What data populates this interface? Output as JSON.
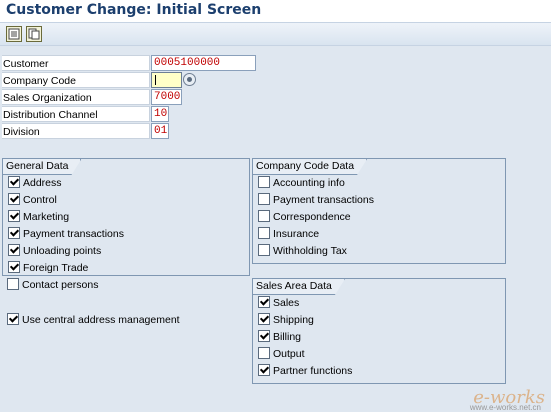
{
  "window": {
    "title": "Customer Change: Initial Screen"
  },
  "toolbar": {
    "buttons": [
      "select-data-icon",
      "copy-icon"
    ]
  },
  "fields": [
    {
      "label": "Customer",
      "value": "0005100000"
    },
    {
      "label": "Company Code",
      "value": ""
    },
    {
      "label": "Sales Organization",
      "value": "7000"
    },
    {
      "label": "Distribution Channel",
      "value": "10"
    },
    {
      "label": "Division",
      "value": "01"
    }
  ],
  "general_data": {
    "title": "General Data",
    "items": [
      {
        "label": "Address",
        "checked": true
      },
      {
        "label": "Control",
        "checked": true
      },
      {
        "label": "Marketing",
        "checked": true
      },
      {
        "label": "Payment transactions",
        "checked": true
      },
      {
        "label": "Unloading points",
        "checked": true
      },
      {
        "label": "Foreign Trade",
        "checked": true
      },
      {
        "label": "Contact persons",
        "checked": false
      }
    ]
  },
  "central_address": {
    "label": "Use central address management",
    "checked": true
  },
  "company_code_data": {
    "title": "Company Code Data",
    "items": [
      {
        "label": "Accounting info",
        "checked": false
      },
      {
        "label": "Payment transactions",
        "checked": false
      },
      {
        "label": "Correspondence",
        "checked": false
      },
      {
        "label": "Insurance",
        "checked": false
      },
      {
        "label": "Withholding Tax",
        "checked": false
      }
    ]
  },
  "sales_area_data": {
    "title": "Sales Area Data",
    "items": [
      {
        "label": "Sales",
        "checked": true
      },
      {
        "label": "Shipping",
        "checked": true
      },
      {
        "label": "Billing",
        "checked": true
      },
      {
        "label": "Output",
        "checked": false
      },
      {
        "label": "Partner functions",
        "checked": true
      }
    ]
  },
  "watermark": {
    "text": "e-works",
    "sub": "www.e-works.net.cn"
  }
}
